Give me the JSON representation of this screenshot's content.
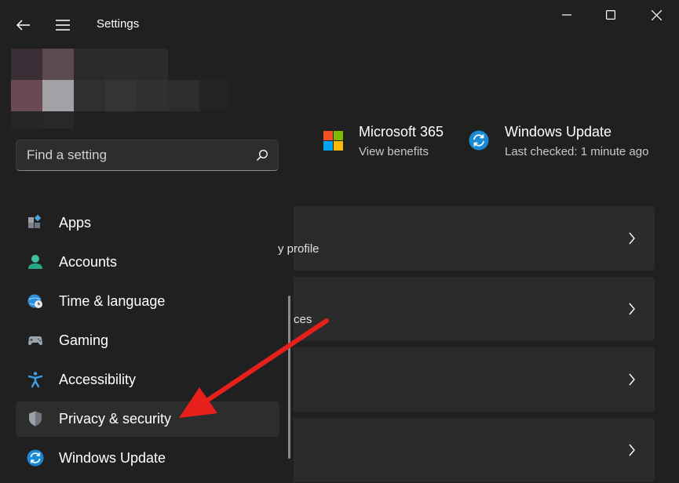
{
  "titlebar": {
    "title": "Settings",
    "icons": {
      "back": "back-arrow-icon",
      "menu": "hamburger-icon",
      "minimize": "minimize-icon",
      "maximize": "maximize-icon",
      "close": "close-icon"
    }
  },
  "search": {
    "placeholder": "Find a setting",
    "value": ""
  },
  "sidebar": {
    "items": [
      {
        "label": "Apps",
        "icon": "apps-icon"
      },
      {
        "label": "Accounts",
        "icon": "accounts-icon"
      },
      {
        "label": "Time & language",
        "icon": "time-language-icon"
      },
      {
        "label": "Gaming",
        "icon": "gaming-icon"
      },
      {
        "label": "Accessibility",
        "icon": "accessibility-icon"
      },
      {
        "label": "Privacy & security",
        "icon": "shield-icon",
        "selected": true
      },
      {
        "label": "Windows Update",
        "icon": "windows-update-icon"
      }
    ]
  },
  "promos": [
    {
      "title": "Microsoft 365",
      "subtitle": "View benefits",
      "icon": "microsoft-logo-icon"
    },
    {
      "title": "Windows Update",
      "subtitle": "Last checked: 1 minute ago",
      "icon": "windows-update-icon"
    }
  ],
  "cards": [
    {
      "text": "y profile"
    },
    {
      "text": "ces"
    },
    {
      "text": ""
    },
    {
      "text": ""
    }
  ],
  "colors": {
    "accent": "#0f6cbd",
    "annotation_arrow": "#e8201c",
    "background": "#202020"
  }
}
